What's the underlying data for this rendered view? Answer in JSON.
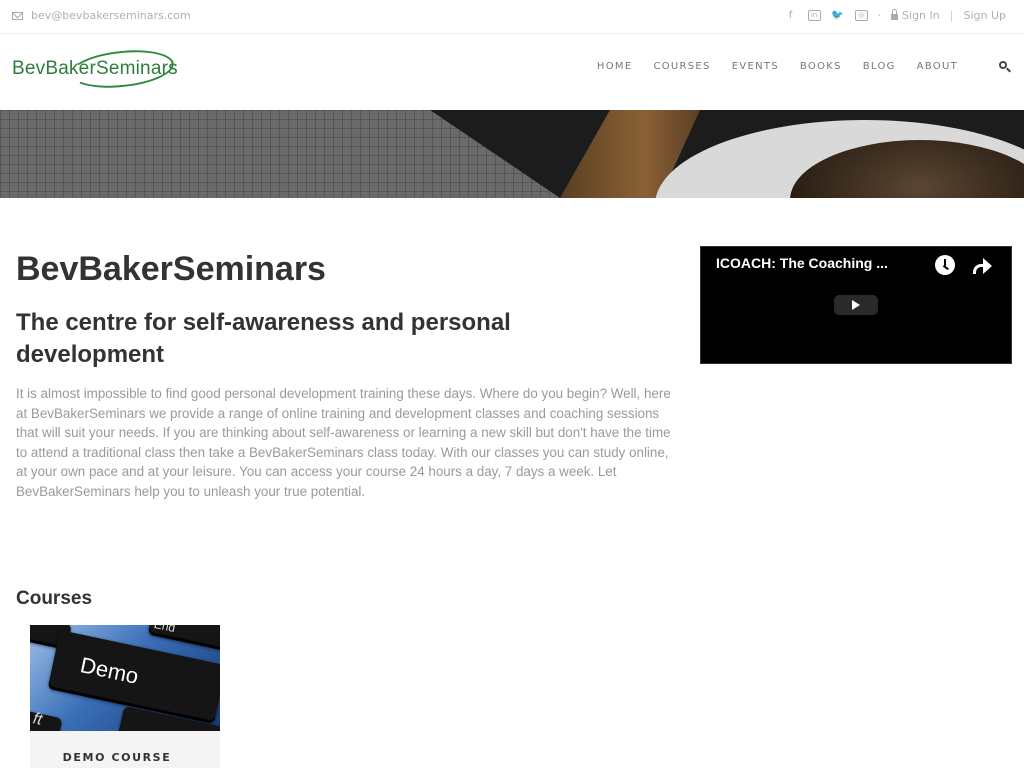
{
  "topbar": {
    "email": "bev@bevbakerseminars.com",
    "social": [
      {
        "icon": "facebook-icon",
        "glyph": "f"
      },
      {
        "icon": "linkedin-icon",
        "glyph": "in"
      },
      {
        "icon": "twitter-icon",
        "glyph": "🐦"
      },
      {
        "icon": "instagram-icon",
        "glyph": "◎"
      }
    ],
    "bullet": "·",
    "sign_in": "Sign In",
    "separator": "|",
    "sign_up": "Sign Up"
  },
  "header": {
    "logo_text": "BevBakerSeminars",
    "nav": [
      "HOME",
      "COURSES",
      "EVENTS",
      "BOOKS",
      "BLOG",
      "ABOUT"
    ]
  },
  "main": {
    "title": "BevBakerSeminars",
    "tagline": "The centre for self-awareness and personal development",
    "intro": "It is almost impossible to find good personal development training these days. Where do you begin? Well, here at BevBakerSeminars we provide a range of online training and development classes and coaching sessions that will suit your needs. If you are thinking about self-awareness or learning a new skill but don't have the time to attend a traditional class then take a BevBakerSeminars class today. With our classes you can study online, at your own pace and at your leisure. You can access your course 24 hours a day, 7 days a week.  Let BevBakerSeminars help you to unleash your true potential.",
    "courses_heading": "Courses",
    "course": {
      "image_text": "Demo",
      "image_key_top": "End",
      "image_key_left": "ft",
      "title": "DEMO COURSE"
    }
  },
  "video": {
    "title": "ICOACH: The Coaching ..."
  },
  "colors": {
    "brand_green": "#2e7d3a",
    "text_dark": "#333333",
    "text_muted": "#9a9a9a"
  }
}
